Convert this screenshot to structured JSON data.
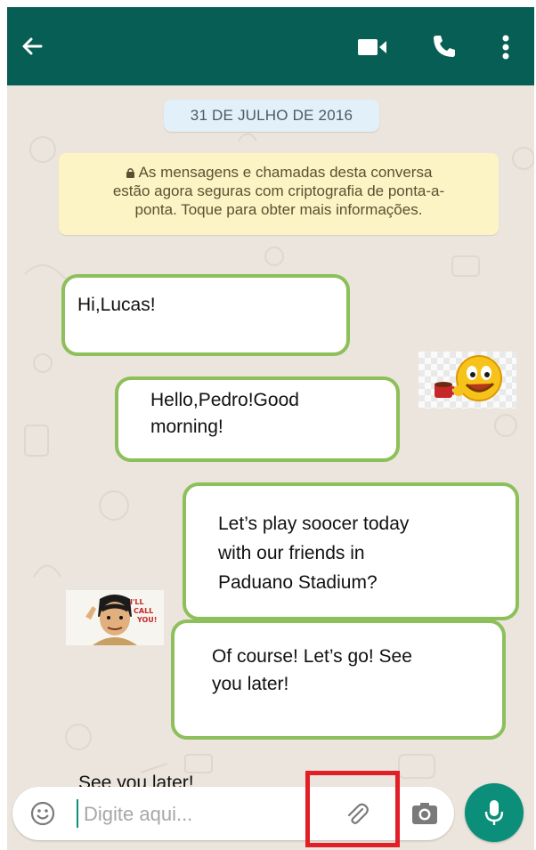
{
  "chat": {
    "date_label": "31 DE JULHO DE 2016",
    "encryption_notice": {
      "line1": "As mensagens e chamadas desta conversa",
      "line2": "estão agora seguras com criptografia de ponta-a-",
      "line3": "ponta. Toque para obter mais informações."
    },
    "messages": [
      {
        "lines": [
          "Hi,Lucas!"
        ]
      },
      {
        "lines": [
          "Hello,Pedro!Good",
          "morning!"
        ]
      },
      {
        "lines": [
          "Let’s play soocer  today",
          "with our friends in",
          "Paduano Stadium?"
        ]
      },
      {
        "lines": [
          "Of course! Let’s  go! See",
          "you later!"
        ]
      }
    ],
    "stickers": [
      "smiley-with-coffee-sticker",
      "ill-call-you-cartoon-sticker"
    ],
    "typed_overlay_text": "See you later!"
  },
  "header": {
    "icons": [
      "back-arrow-icon",
      "video-call-icon",
      "phone-call-icon",
      "more-options-icon"
    ],
    "color": "#075e54"
  },
  "input": {
    "placeholder": "Digite aqui...",
    "icons": [
      "emoji-icon",
      "attach-icon",
      "camera-icon",
      "mic-icon"
    ]
  },
  "colors": {
    "bubble_border": "#8dbf5a",
    "accent": "#0b8f7a",
    "highlight_box": "#e21f26",
    "notice_bg": "#fdf4c5",
    "date_bg": "#e1f0f9"
  }
}
